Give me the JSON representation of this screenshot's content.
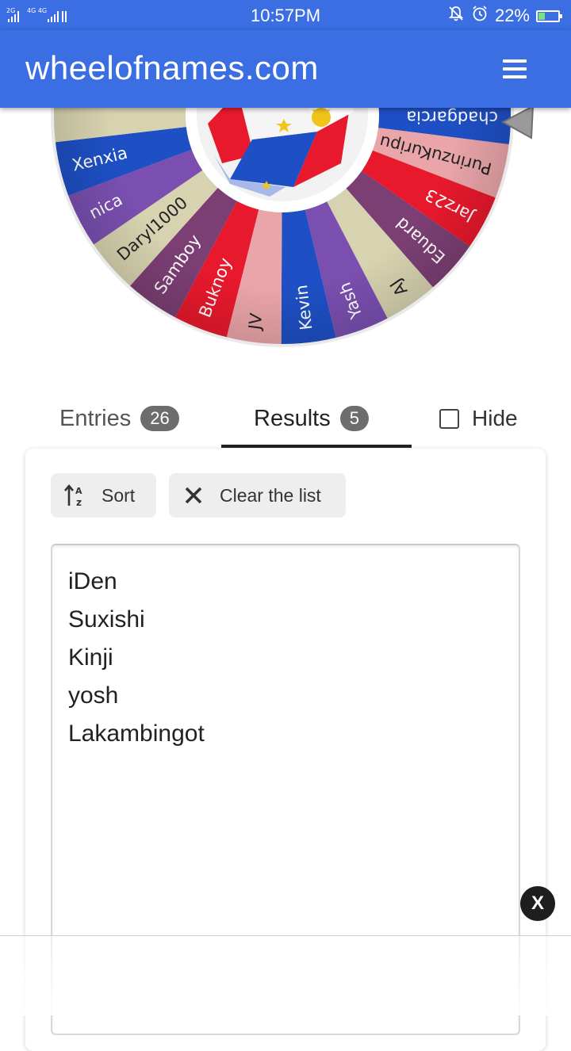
{
  "status_bar": {
    "network": "2G 4G 4G",
    "time": "10:57PM",
    "battery": "22%",
    "icons": [
      "mute-icon",
      "alarm-icon",
      "battery-charging-icon"
    ]
  },
  "app": {
    "title": "wheelofnames.com",
    "menu_icon": "hamburger-menu-icon"
  },
  "wheel": {
    "pointer_icon": "pointer-triangle-icon",
    "center_image": "flag-cube",
    "colors": [
      "#1e4fc4",
      "#7a4fb0",
      "#d7d3b0",
      "#7c3f74",
      "#e8192c",
      "#eaa5a8"
    ],
    "visible_segments": [
      {
        "label": "Lakambingot",
        "color": "#7a4fb0"
      },
      {
        "label": "chadgarcia",
        "color": "#1e4fc4"
      },
      {
        "label": "PurinzuKuripu",
        "color": "#eaa5a8"
      },
      {
        "label": "Jarz23",
        "color": "#e8192c"
      },
      {
        "label": "Eduard",
        "color": "#7c3f74"
      },
      {
        "label": "AJ",
        "color": "#d7d3b0"
      },
      {
        "label": "Yash",
        "color": "#7a4fb0"
      },
      {
        "label": "Kevin",
        "color": "#1e4fc4"
      },
      {
        "label": "JV",
        "color": "#eaa5a8"
      },
      {
        "label": "Buknoy",
        "color": "#e8192c"
      },
      {
        "label": "Samboy",
        "color": "#7c3f74"
      },
      {
        "label": "Daryl1000",
        "color": "#d7d3b0"
      },
      {
        "label": "nica",
        "color": "#7a4fb0"
      },
      {
        "label": "Xenxia",
        "color": "#1e4fc4"
      }
    ]
  },
  "tabs": {
    "entries_label": "Entries",
    "entries_count": "26",
    "results_label": "Results",
    "results_count": "5",
    "hide_label": "Hide"
  },
  "toolbar": {
    "sort_label": "Sort",
    "clear_label": "Clear the list"
  },
  "results": [
    "iDen",
    "Suxishi",
    "Kinji",
    "yosh",
    "Lakambingot"
  ],
  "ad": {
    "close_label": "X"
  }
}
